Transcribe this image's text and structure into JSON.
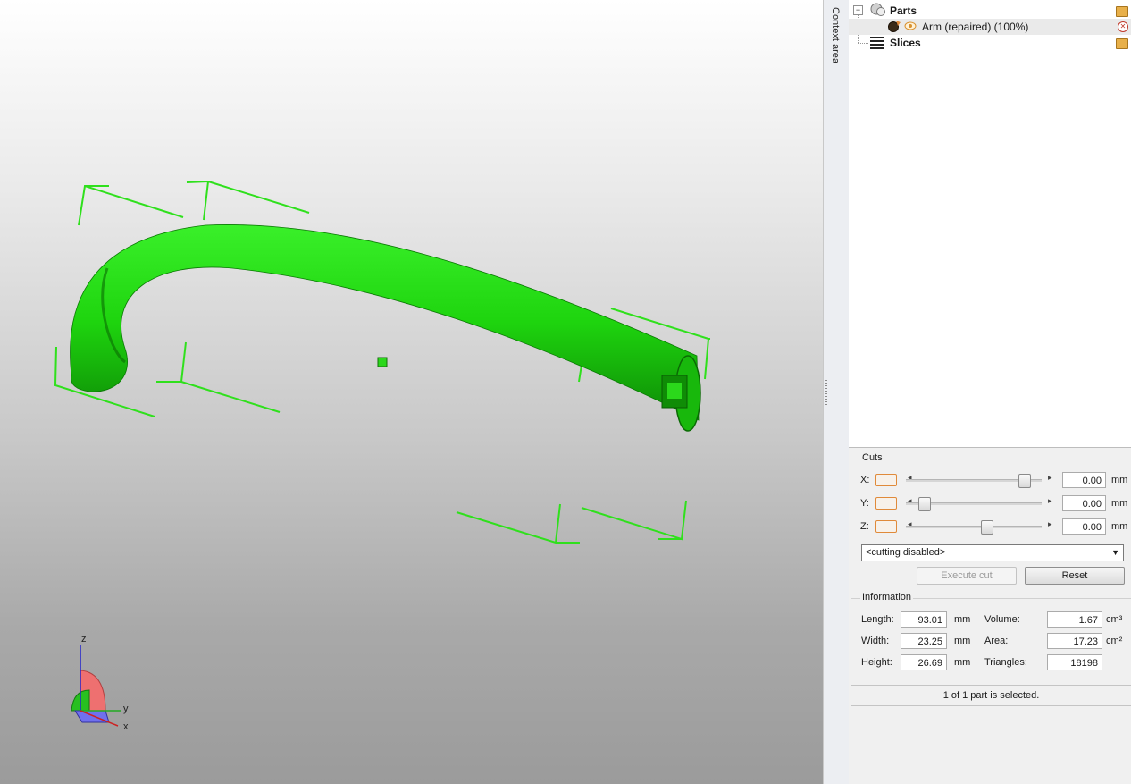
{
  "context_area": {
    "label": "Context area"
  },
  "tree": {
    "parts_label": "Parts",
    "part_item_label": "Arm (repaired) (100%)",
    "slices_label": "Slices"
  },
  "cuts": {
    "title": "Cuts",
    "axes": [
      {
        "name": "X:",
        "value": "0.00",
        "unit": "mm",
        "slider_fraction": 0.9
      },
      {
        "name": "Y:",
        "value": "0.00",
        "unit": "mm",
        "slider_fraction": 0.1
      },
      {
        "name": "Z:",
        "value": "0.00",
        "unit": "mm",
        "slider_fraction": 0.6
      }
    ],
    "mode_selected": "<cutting disabled>",
    "execute_label": "Execute cut",
    "reset_label": "Reset"
  },
  "information": {
    "title": "Information",
    "length_label": "Length:",
    "length_value": "93.01",
    "length_unit": "mm",
    "width_label": "Width:",
    "width_value": "23.25",
    "width_unit": "mm",
    "height_label": "Height:",
    "height_value": "26.69",
    "height_unit": "mm",
    "volume_label": "Volume:",
    "volume_value": "1.67",
    "volume_unit": "cm³",
    "area_label": "Area:",
    "area_value": "17.23",
    "area_unit": "cm²",
    "triangles_label": "Triangles:",
    "triangles_value": "18198"
  },
  "status": {
    "text": "1 of 1 part is selected."
  },
  "axes_gizmo": {
    "z_label": "z",
    "y_label": "y",
    "x_label": "x"
  },
  "colors": {
    "model": "#22cc00",
    "bbox": "#33dd22",
    "accent": "#e08a3a"
  }
}
